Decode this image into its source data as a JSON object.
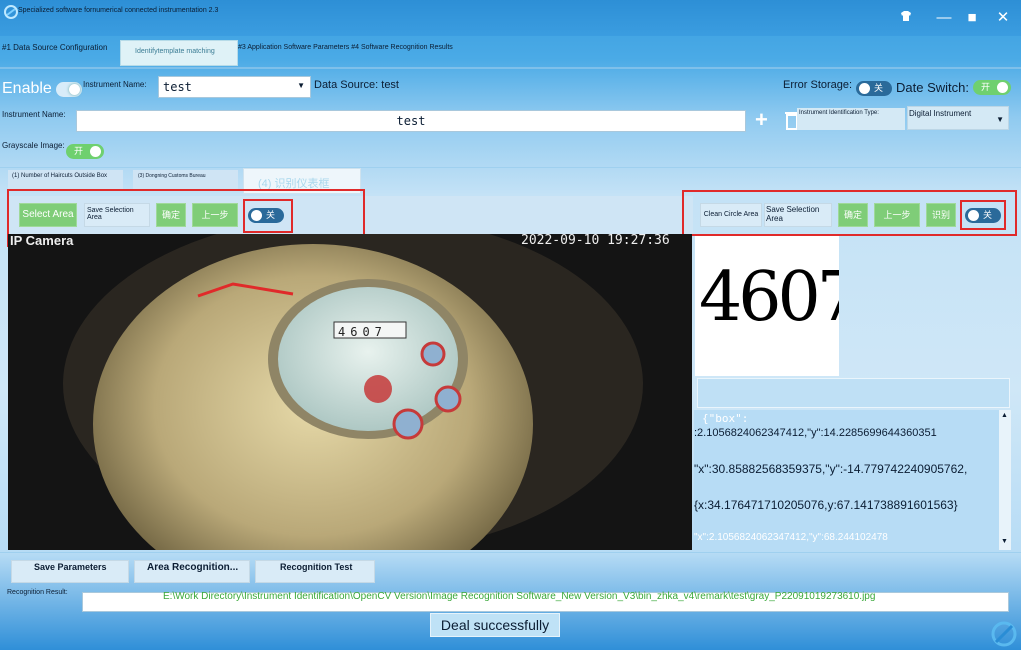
{
  "window": {
    "title": "Specialized software fornumerical connected instrumentation 2.3",
    "controls": {
      "minimize": "—",
      "maximize": "■",
      "close": "✕"
    }
  },
  "tabs": [
    {
      "label": "#1 Data Source Configuration"
    },
    {
      "label": "Identifytemplate matching"
    },
    {
      "label": "#3 Application Software Parameters #4 Software Recognition Results"
    }
  ],
  "row1": {
    "enable_label": "Enable",
    "instrument_name_label": "Instrument Name:",
    "instrument_name_value": "test",
    "data_source_label": "Data Source: test",
    "error_storage_label": "Error Storage:",
    "error_storage_state": "关",
    "date_switch_label": "Date Switch:",
    "date_switch_state": "开"
  },
  "row2": {
    "instrument_name_label": "Instrument Name:",
    "instrument_name_value": "test",
    "add_glyph": "+",
    "id_type_label": "Instrument Identification Type:",
    "id_type_value": "Digital Instrument"
  },
  "row3": {
    "grayscale_label": "Grayscale Image:",
    "grayscale_state": "开"
  },
  "subtabs": [
    {
      "label": "(1) Number of Haircuts Outside Box"
    },
    {
      "label": "(3) Dongning Customs Bureau"
    },
    {
      "label": "(4) 识别仪表框"
    }
  ],
  "left_toolbar": {
    "select_area": "Select Area",
    "save_selection": "Save Selection Area",
    "btn3": "确定",
    "btn4": "上一步",
    "toggle_state": "关"
  },
  "right_toolbar": {
    "clean_circle": "Clean Circle Area",
    "save_selection": "Save Selection Area",
    "btn3": "确定",
    "btn4": "上一步",
    "btn5": "识别",
    "toggle_state": "关"
  },
  "camera": {
    "label": "IP Camera",
    "timestamp": "2022-09-10 19:27:36",
    "dial_digits": "4607"
  },
  "crop_digits": "4607",
  "json_output": {
    "lines": [
      "{\"box\":",
      ":2.1056824062347412,\"y\":14.2285699644360351",
      "\"x\":30.85882568359375,\"y\":-14.779742240905762,",
      "{x:34.176471710205076,y:67.141738891601563}",
      "\"x\":2.1056824062347412,\"y\":68.244102478"
    ]
  },
  "bottom": {
    "save_params": "Save Parameters",
    "area_recognition": "Area Recognition...",
    "recognition_test": "Recognition Test",
    "result_label": "Recognition Result:",
    "result_path": "E:\\Work Directory\\Instrument Identification\\OpenCV Version\\Image Recognition Software_New Version_V3\\bin_zhka_v4\\remark\\test\\gray_P22091019273610.jpg",
    "status": "Deal successfully"
  },
  "colors": {
    "accent_green": "#6fd06f",
    "highlight_red": "#e02a2a",
    "path_green": "#3aa83a"
  }
}
